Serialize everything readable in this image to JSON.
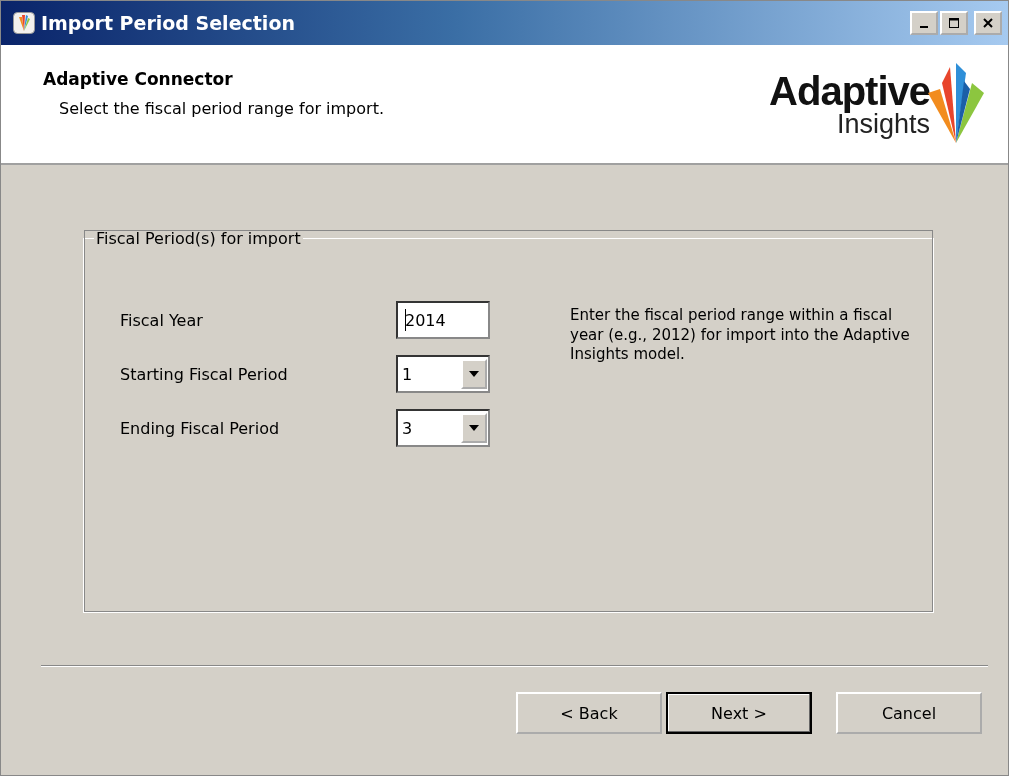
{
  "window": {
    "title": "Import Period Selection"
  },
  "header": {
    "title": "Adaptive Connector",
    "subtitle": "Select the fiscal period range for import.",
    "logo": {
      "line_1": "Adaptive",
      "line_2": "Insights"
    }
  },
  "group": {
    "title": "Fiscal Period(s) for import",
    "fields": [
      {
        "label": "Fiscal Year",
        "kind": "text",
        "value": "2014",
        "focused": true
      },
      {
        "label": "Starting Fiscal Period",
        "kind": "dropdown",
        "value": "1",
        "focused": false
      },
      {
        "label": "Ending Fiscal Period",
        "kind": "dropdown",
        "value": "3",
        "focused": false
      }
    ],
    "help": "Enter the fiscal period range within a fiscal year (e.g., 2012) for import into the Adaptive Insights model."
  },
  "buttons": [
    {
      "label": "< Back",
      "default": false
    },
    {
      "label": "Next >",
      "default": true
    },
    {
      "label": "Cancel",
      "default": false
    }
  ]
}
